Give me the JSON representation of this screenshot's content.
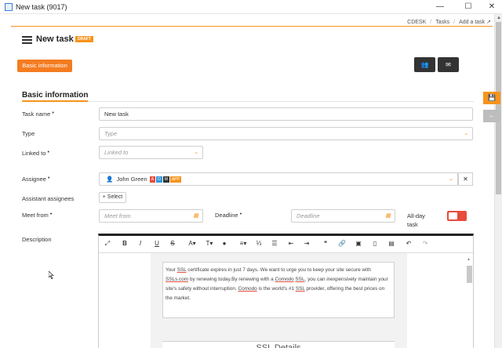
{
  "window": {
    "title": "New task (9017)",
    "minimize": "—",
    "maximize": "☐",
    "close": "✕"
  },
  "breadcrumb": {
    "items": [
      "CDESK",
      "Tasks",
      "Add a task"
    ],
    "separator": "/",
    "external_icon": "↗"
  },
  "header": {
    "title": "New task",
    "badge": "DRAFT"
  },
  "buttons": {
    "basic_info": "Basic information",
    "team_icon": "👥",
    "mail_icon": "✉",
    "select": "+ Select"
  },
  "section": {
    "title": "Basic information"
  },
  "form": {
    "task_name_label": "Task name",
    "task_name_value": "New task",
    "type_label": "Type",
    "type_placeholder": "Type",
    "linked_label": "Linked to",
    "linked_placeholder": "Linked to",
    "assignee_label": "Assignee",
    "assignee_value": "John Green",
    "assignee_tags": [
      {
        "text": "A",
        "color": "#e74c3c"
      },
      {
        "text": "D",
        "color": "#3498db"
      },
      {
        "text": "M",
        "color": "#333333"
      },
      {
        "text": "APP",
        "color": "#f7941d"
      }
    ],
    "assistant_label": "Assistant assignees",
    "meet_from_label": "Meet from",
    "meet_from_placeholder": "Meet from",
    "deadline_label": "Deadline",
    "deadline_placeholder": "Deadline",
    "allday_label_1": "All-day",
    "allday_label_2": "task",
    "description_label": "Description",
    "required_mark": "•"
  },
  "editor": {
    "line1_a": "Your ",
    "line1_b": "SSL",
    "line1_c": " certificate expires in just 7 days. We want to urge you to keep your site secure with",
    "line2_a": "SSLs.com",
    "line2_b": " by renewing today.By renewing with a ",
    "line2_c": "Comodo",
    "line2_d": " ",
    "line2_e": "SSL",
    "line2_f": ", you can inexpensively maintain your",
    "line3_a": "site's safety without interruption. ",
    "line3_b": "Comodo",
    "line3_c": " is the world's #1 ",
    "line3_d": "SSL",
    "line3_e": " provider, offering the best prices on",
    "line4": "the market.",
    "heading2": "SSL Details"
  },
  "side": {
    "save_icon": "💾",
    "back_icon": "←"
  },
  "colors": {
    "accent": "#f7941d",
    "dark_button": "#333333",
    "toggle_off": "#e74c3c"
  }
}
